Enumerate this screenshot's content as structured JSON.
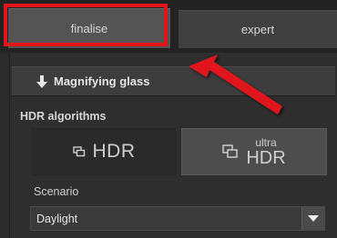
{
  "tabs": [
    {
      "label": "finalise",
      "active": true
    },
    {
      "label": "expert",
      "active": false
    }
  ],
  "magnifier": {
    "label": "Magnifying glass",
    "icon": "arrow-down-icon"
  },
  "hdr_section": {
    "title": "HDR algorithms",
    "options": [
      {
        "label": "HDR",
        "icon": "copy-icon",
        "selected": false
      },
      {
        "label_small": "ultra",
        "label_big": "HDR",
        "icon": "copy-icon",
        "selected": true
      }
    ]
  },
  "scenario": {
    "label": "Scenario",
    "value": "Daylight"
  },
  "annotation": {
    "color": "#e0161b"
  }
}
